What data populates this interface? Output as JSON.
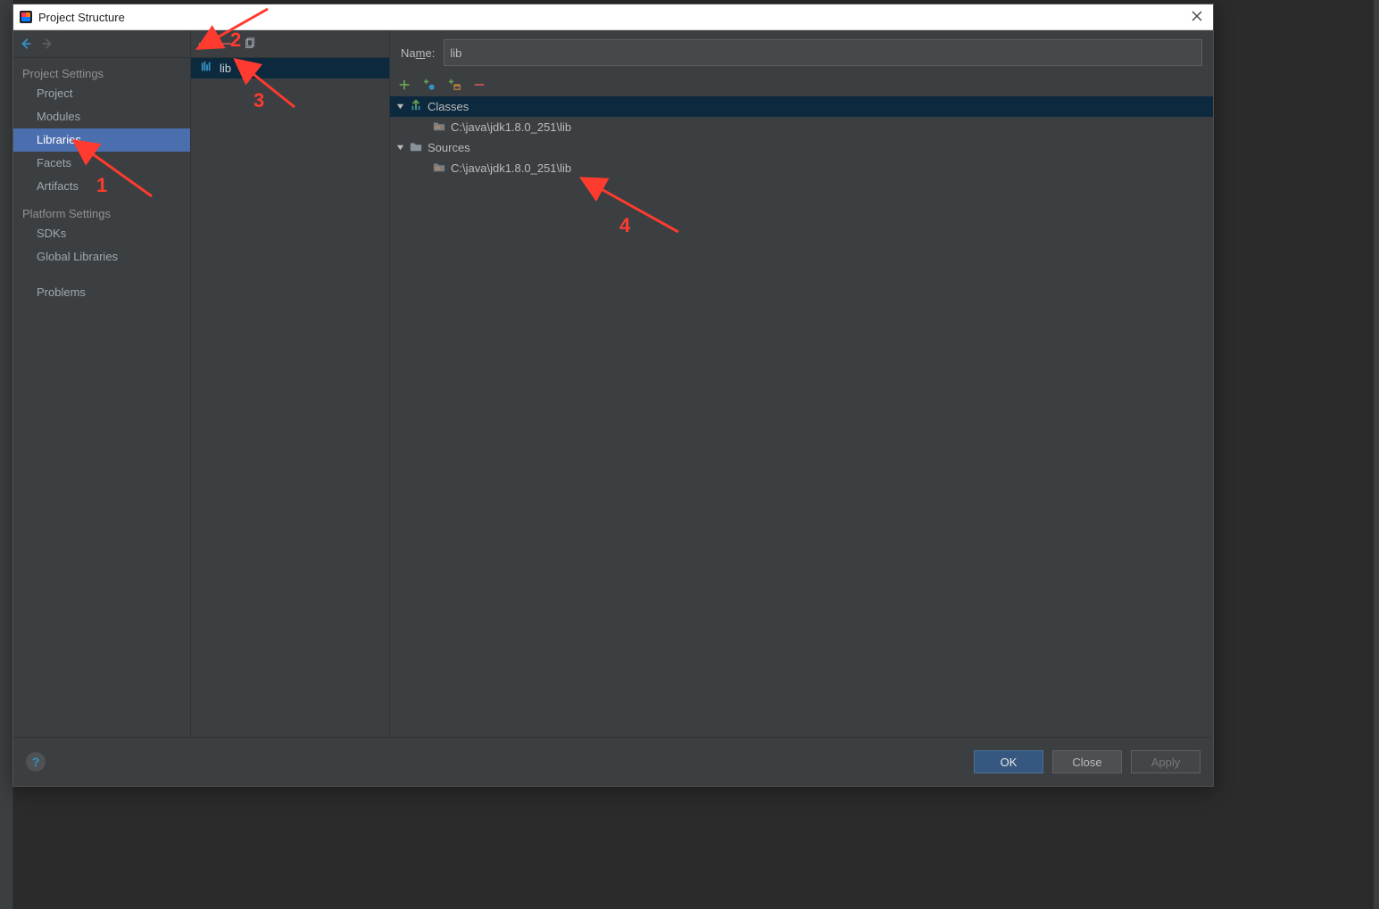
{
  "window": {
    "title": "Project Structure"
  },
  "sidebar": {
    "sections": [
      {
        "header": "Project Settings",
        "items": [
          "Project",
          "Modules",
          "Libraries",
          "Facets",
          "Artifacts"
        ],
        "selected_index": 2
      },
      {
        "header": "Platform Settings",
        "items": [
          "SDKs",
          "Global Libraries"
        ]
      }
    ],
    "extra": [
      "Problems"
    ]
  },
  "libraries": {
    "items": [
      "lib"
    ],
    "selected_index": 0
  },
  "details": {
    "name_label_prefix": "Na",
    "name_label_mnemonic": "m",
    "name_label_suffix": "e:",
    "name_value": "lib",
    "tree": [
      {
        "type": "group",
        "label": "Classes",
        "icon": "classes",
        "selected": true
      },
      {
        "type": "leaf",
        "label": "C:\\java\\jdk1.8.0_251\\lib",
        "icon": "folder-jar"
      },
      {
        "type": "group",
        "label": "Sources",
        "icon": "folder"
      },
      {
        "type": "leaf",
        "label": "C:\\java\\jdk1.8.0_251\\lib",
        "icon": "folder-jar"
      }
    ]
  },
  "footer": {
    "ok": "OK",
    "close": "Close",
    "apply": "Apply"
  },
  "annotations": {
    "n1": "1",
    "n2": "2",
    "n3": "3",
    "n4": "4"
  }
}
